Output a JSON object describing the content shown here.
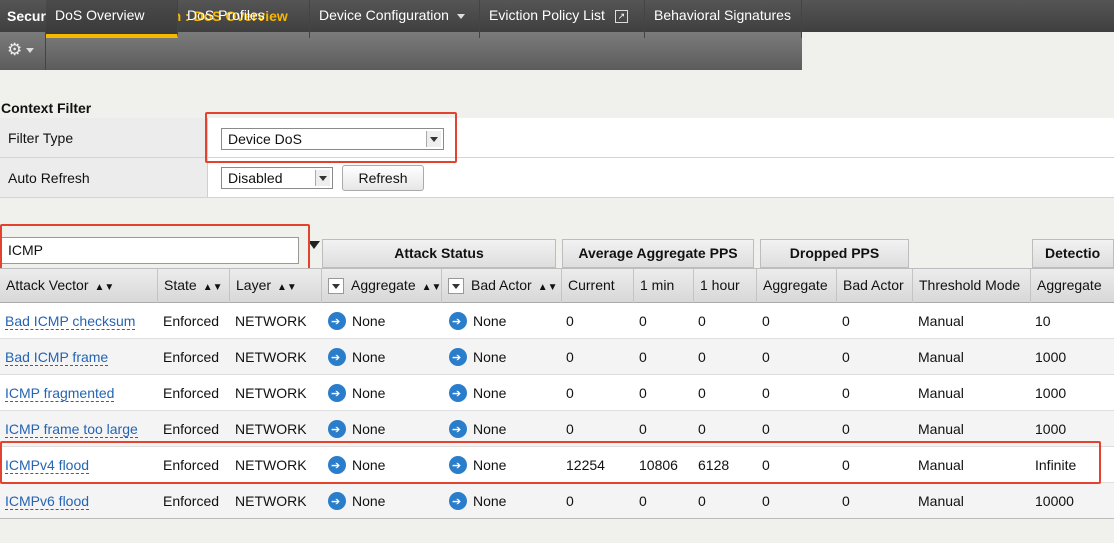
{
  "breadcrumb": {
    "section": "Security",
    "separator": "»",
    "current": "DoS Protection : DoS Overview"
  },
  "tabs": [
    {
      "label": "DoS Overview",
      "active": true
    },
    {
      "label": "DoS Profiles"
    },
    {
      "label": "Device Configuration"
    },
    {
      "label": "Eviction Policy List"
    },
    {
      "label": "Behavioral Signatures"
    }
  ],
  "icons": {
    "gear": "gear-icon",
    "external": "external-link-icon",
    "filter": "funnel-icon",
    "action": "right-arrow-circle-icon"
  },
  "colors": {
    "accent": "#f6b800",
    "link": "#2464b3",
    "highlight": "#e3432e",
    "action": "#2a7dcb"
  },
  "context_filter": {
    "title": "Context Filter",
    "filter_type_label": "Filter Type",
    "filter_type_value": "Device DoS",
    "auto_refresh_label": "Auto Refresh",
    "auto_refresh_value": "Disabled",
    "refresh_button": "Refresh"
  },
  "search": {
    "value": "ICMP"
  },
  "groups": {
    "attack_status": "Attack Status",
    "average_pps": "Average Aggregate PPS",
    "dropped_pps": "Dropped PPS",
    "detection": "Detectio"
  },
  "columns": [
    "Attack Vector",
    "State",
    "Layer",
    "Aggregate",
    "Bad Actor",
    "Current",
    "1 min",
    "1 hour",
    "Aggregate",
    "Bad Actor",
    "Threshold Mode",
    "Aggregate"
  ],
  "rows": [
    {
      "vector": "Bad ICMP checksum",
      "state": "Enforced",
      "layer": "NETWORK",
      "agg": "None",
      "bad": "None",
      "current": "0",
      "min1": "0",
      "hour1": "0",
      "d_agg": "0",
      "d_bad": "0",
      "mode": "Manual",
      "det": "10"
    },
    {
      "vector": "Bad ICMP frame",
      "state": "Enforced",
      "layer": "NETWORK",
      "agg": "None",
      "bad": "None",
      "current": "0",
      "min1": "0",
      "hour1": "0",
      "d_agg": "0",
      "d_bad": "0",
      "mode": "Manual",
      "det": "1000"
    },
    {
      "vector": "ICMP fragmented",
      "state": "Enforced",
      "layer": "NETWORK",
      "agg": "None",
      "bad": "None",
      "current": "0",
      "min1": "0",
      "hour1": "0",
      "d_agg": "0",
      "d_bad": "0",
      "mode": "Manual",
      "det": "1000"
    },
    {
      "vector": "ICMP frame too large",
      "state": "Enforced",
      "layer": "NETWORK",
      "agg": "None",
      "bad": "None",
      "current": "0",
      "min1": "0",
      "hour1": "0",
      "d_agg": "0",
      "d_bad": "0",
      "mode": "Manual",
      "det": "1000"
    },
    {
      "vector": "ICMPv4 flood",
      "state": "Enforced",
      "layer": "NETWORK",
      "agg": "None",
      "bad": "None",
      "current": "12254",
      "min1": "10806",
      "hour1": "6128",
      "d_agg": "0",
      "d_bad": "0",
      "mode": "Manual",
      "det": "Infinite"
    },
    {
      "vector": "ICMPv6 flood",
      "state": "Enforced",
      "layer": "NETWORK",
      "agg": "None",
      "bad": "None",
      "current": "0",
      "min1": "0",
      "hour1": "0",
      "d_agg": "0",
      "d_bad": "0",
      "mode": "Manual",
      "det": "10000"
    }
  ]
}
